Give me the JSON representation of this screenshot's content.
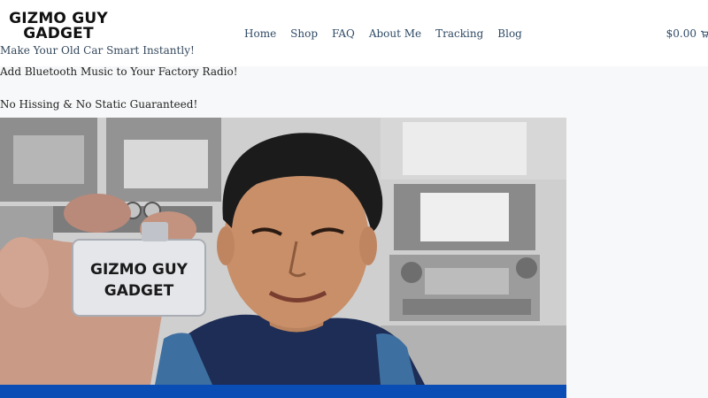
{
  "header": {
    "logo": {
      "line1": "GIZMO GUY",
      "line2": "GADGET"
    },
    "tagline": "Make Your Old Car Smart Instantly!",
    "nav": [
      "Home",
      "Shop",
      "FAQ",
      "About Me",
      "Tracking",
      "Blog"
    ],
    "cart": {
      "amount": "$0.00",
      "icon": "cart-icon"
    }
  },
  "main": {
    "headline1": "Add Bluetooth Music to Your Factory Radio!",
    "headline2": "No Hissing & No Static Guaranteed!",
    "hero": {
      "device_label_line1": "GIZMO GUY",
      "device_label_line2": "GADGET"
    }
  },
  "colors": {
    "nav": "#2f4a66",
    "accent_bar": "#0a4db5",
    "background": "#f7f8f9"
  }
}
